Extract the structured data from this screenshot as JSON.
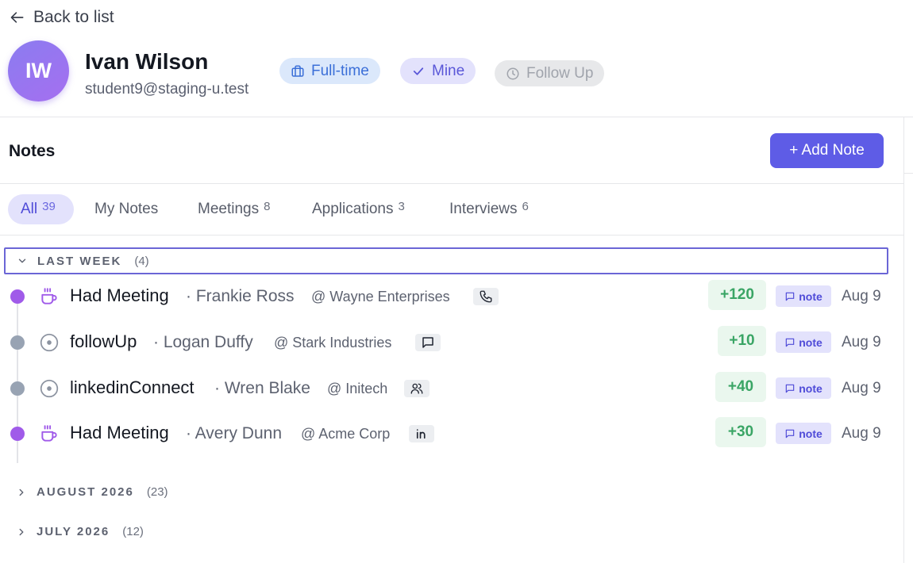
{
  "nav": {
    "back_label": "Back to list"
  },
  "profile": {
    "initials": "IW",
    "name": "Ivan Wilson",
    "email": "student9@staging-u.test",
    "badges": [
      {
        "label": "Full-time",
        "icon": "briefcase-icon",
        "color": "#3b6fd8"
      },
      {
        "label": "Mine",
        "icon": "check-icon",
        "color": "#5a57d8"
      },
      {
        "label": "Follow Up",
        "icon": "clock-icon",
        "color": "#a0a4ac"
      }
    ]
  },
  "notes": {
    "title": "Notes",
    "add_label": "+ Add Note",
    "tabs": [
      {
        "label": "All",
        "count": "39",
        "active": true
      },
      {
        "label": "My Notes",
        "count": ""
      },
      {
        "label": "Meetings",
        "count": "8"
      },
      {
        "label": "Applications",
        "count": "3"
      },
      {
        "label": "Interviews",
        "count": "6"
      }
    ],
    "groups": [
      {
        "label": "LAST WEEK",
        "count": "(4)",
        "expanded": true,
        "items": [
          {
            "title": "Had Meeting",
            "contact": "· Frankie Ross",
            "company": "@ Wayne Enterprises",
            "channel_icon": "phone-icon",
            "type_icon": "coffee-icon",
            "points": "+120",
            "tag": "note",
            "date": "Aug 9",
            "dot_color": "#a05be9"
          },
          {
            "title": "followUp",
            "contact": "· Logan Duffy",
            "company": "@ Stark Industries",
            "channel_icon": "message-icon",
            "type_icon": "target-icon",
            "points": "+10",
            "tag": "note",
            "date": "Aug 9",
            "dot_color": "#98a3b3"
          },
          {
            "title": "linkedinConnect",
            "contact": "· Wren Blake",
            "company": "@ Initech",
            "channel_icon": "users-icon",
            "type_icon": "target-icon",
            "points": "+40",
            "tag": "note",
            "date": "Aug 9",
            "dot_color": "#98a3b3"
          },
          {
            "title": "Had Meeting",
            "contact": "· Avery Dunn",
            "company": "@ Acme Corp",
            "channel_icon": "linkedin-icon",
            "type_icon": "coffee-icon",
            "points": "+30",
            "tag": "note",
            "date": "Aug 9",
            "dot_color": "#a05be9"
          }
        ]
      },
      {
        "label": "AUGUST 2026",
        "count": "(23)",
        "expanded": false
      },
      {
        "label": "JULY 2026",
        "count": "(12)",
        "expanded": false
      }
    ]
  },
  "colors": {
    "accent": "#5e5ce6",
    "points_green": "#3aa565"
  }
}
